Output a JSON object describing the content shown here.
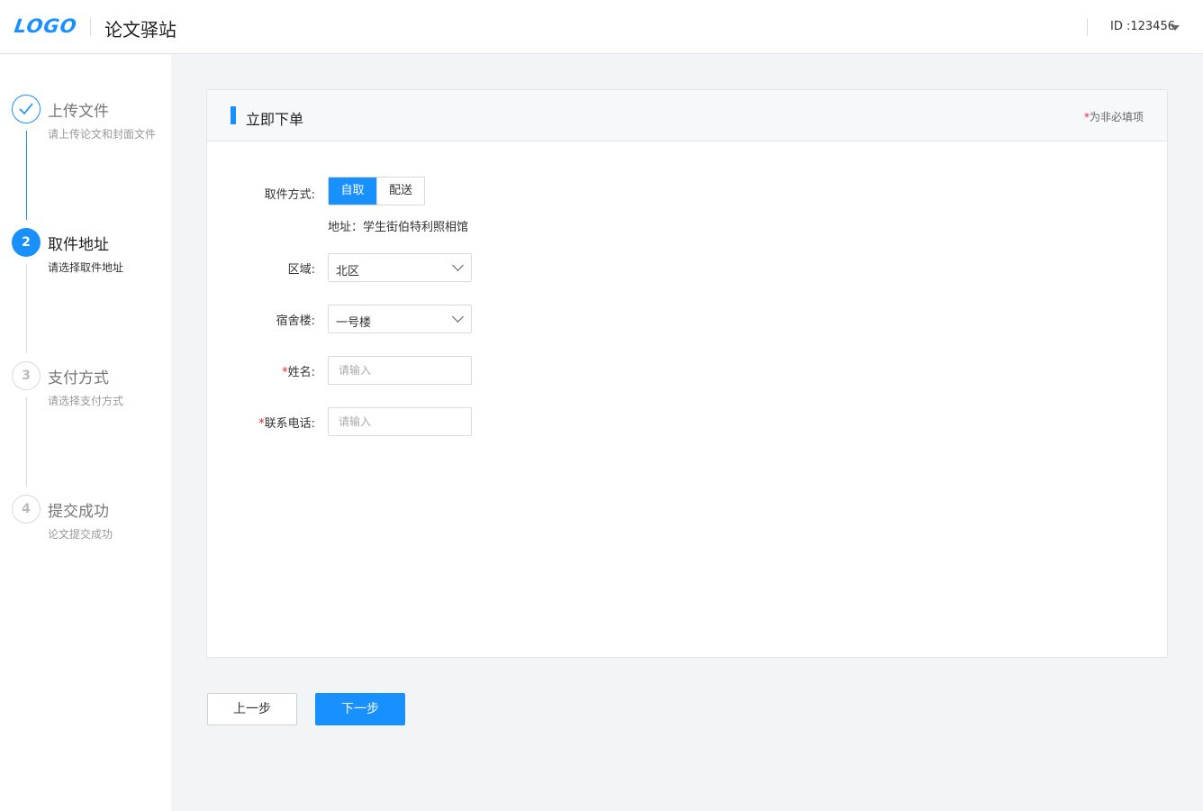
{
  "header": {
    "logo": "LOGO",
    "app_title": "论文驿站",
    "user_id": "ID :123456"
  },
  "steps": [
    {
      "number": "✓",
      "title": "上传文件",
      "desc": "请上传论文和封面文件",
      "state": "done"
    },
    {
      "number": "2",
      "title": "取件地址",
      "desc": "请选择取件地址",
      "state": "active"
    },
    {
      "number": "3",
      "title": "支付方式",
      "desc": "请选择支付方式",
      "state": "todo"
    },
    {
      "number": "4",
      "title": "提交成功",
      "desc": "论文提交成功",
      "state": "todo"
    }
  ],
  "card": {
    "title": "立即下单",
    "note_star": "*",
    "note": "为非必填项"
  },
  "form": {
    "pickup_label": "取件方式:",
    "pickup_options": [
      "自取",
      "配送"
    ],
    "pickup_selected": "自取",
    "address": "地址：学生街伯特利照相馆",
    "region_label": "区域:",
    "region_value": "北区",
    "dorm_label": "宿舍楼:",
    "dorm_value": "一号楼",
    "name_star": "*",
    "name_label": "姓名:",
    "name_placeholder": "请输入",
    "phone_star": "*",
    "phone_label": "联系电话:",
    "phone_placeholder": "请输入"
  },
  "buttons": {
    "prev": "上一步",
    "next": "下一步"
  },
  "colors": {
    "accent": "#1890ff",
    "required": "#f5222d"
  }
}
